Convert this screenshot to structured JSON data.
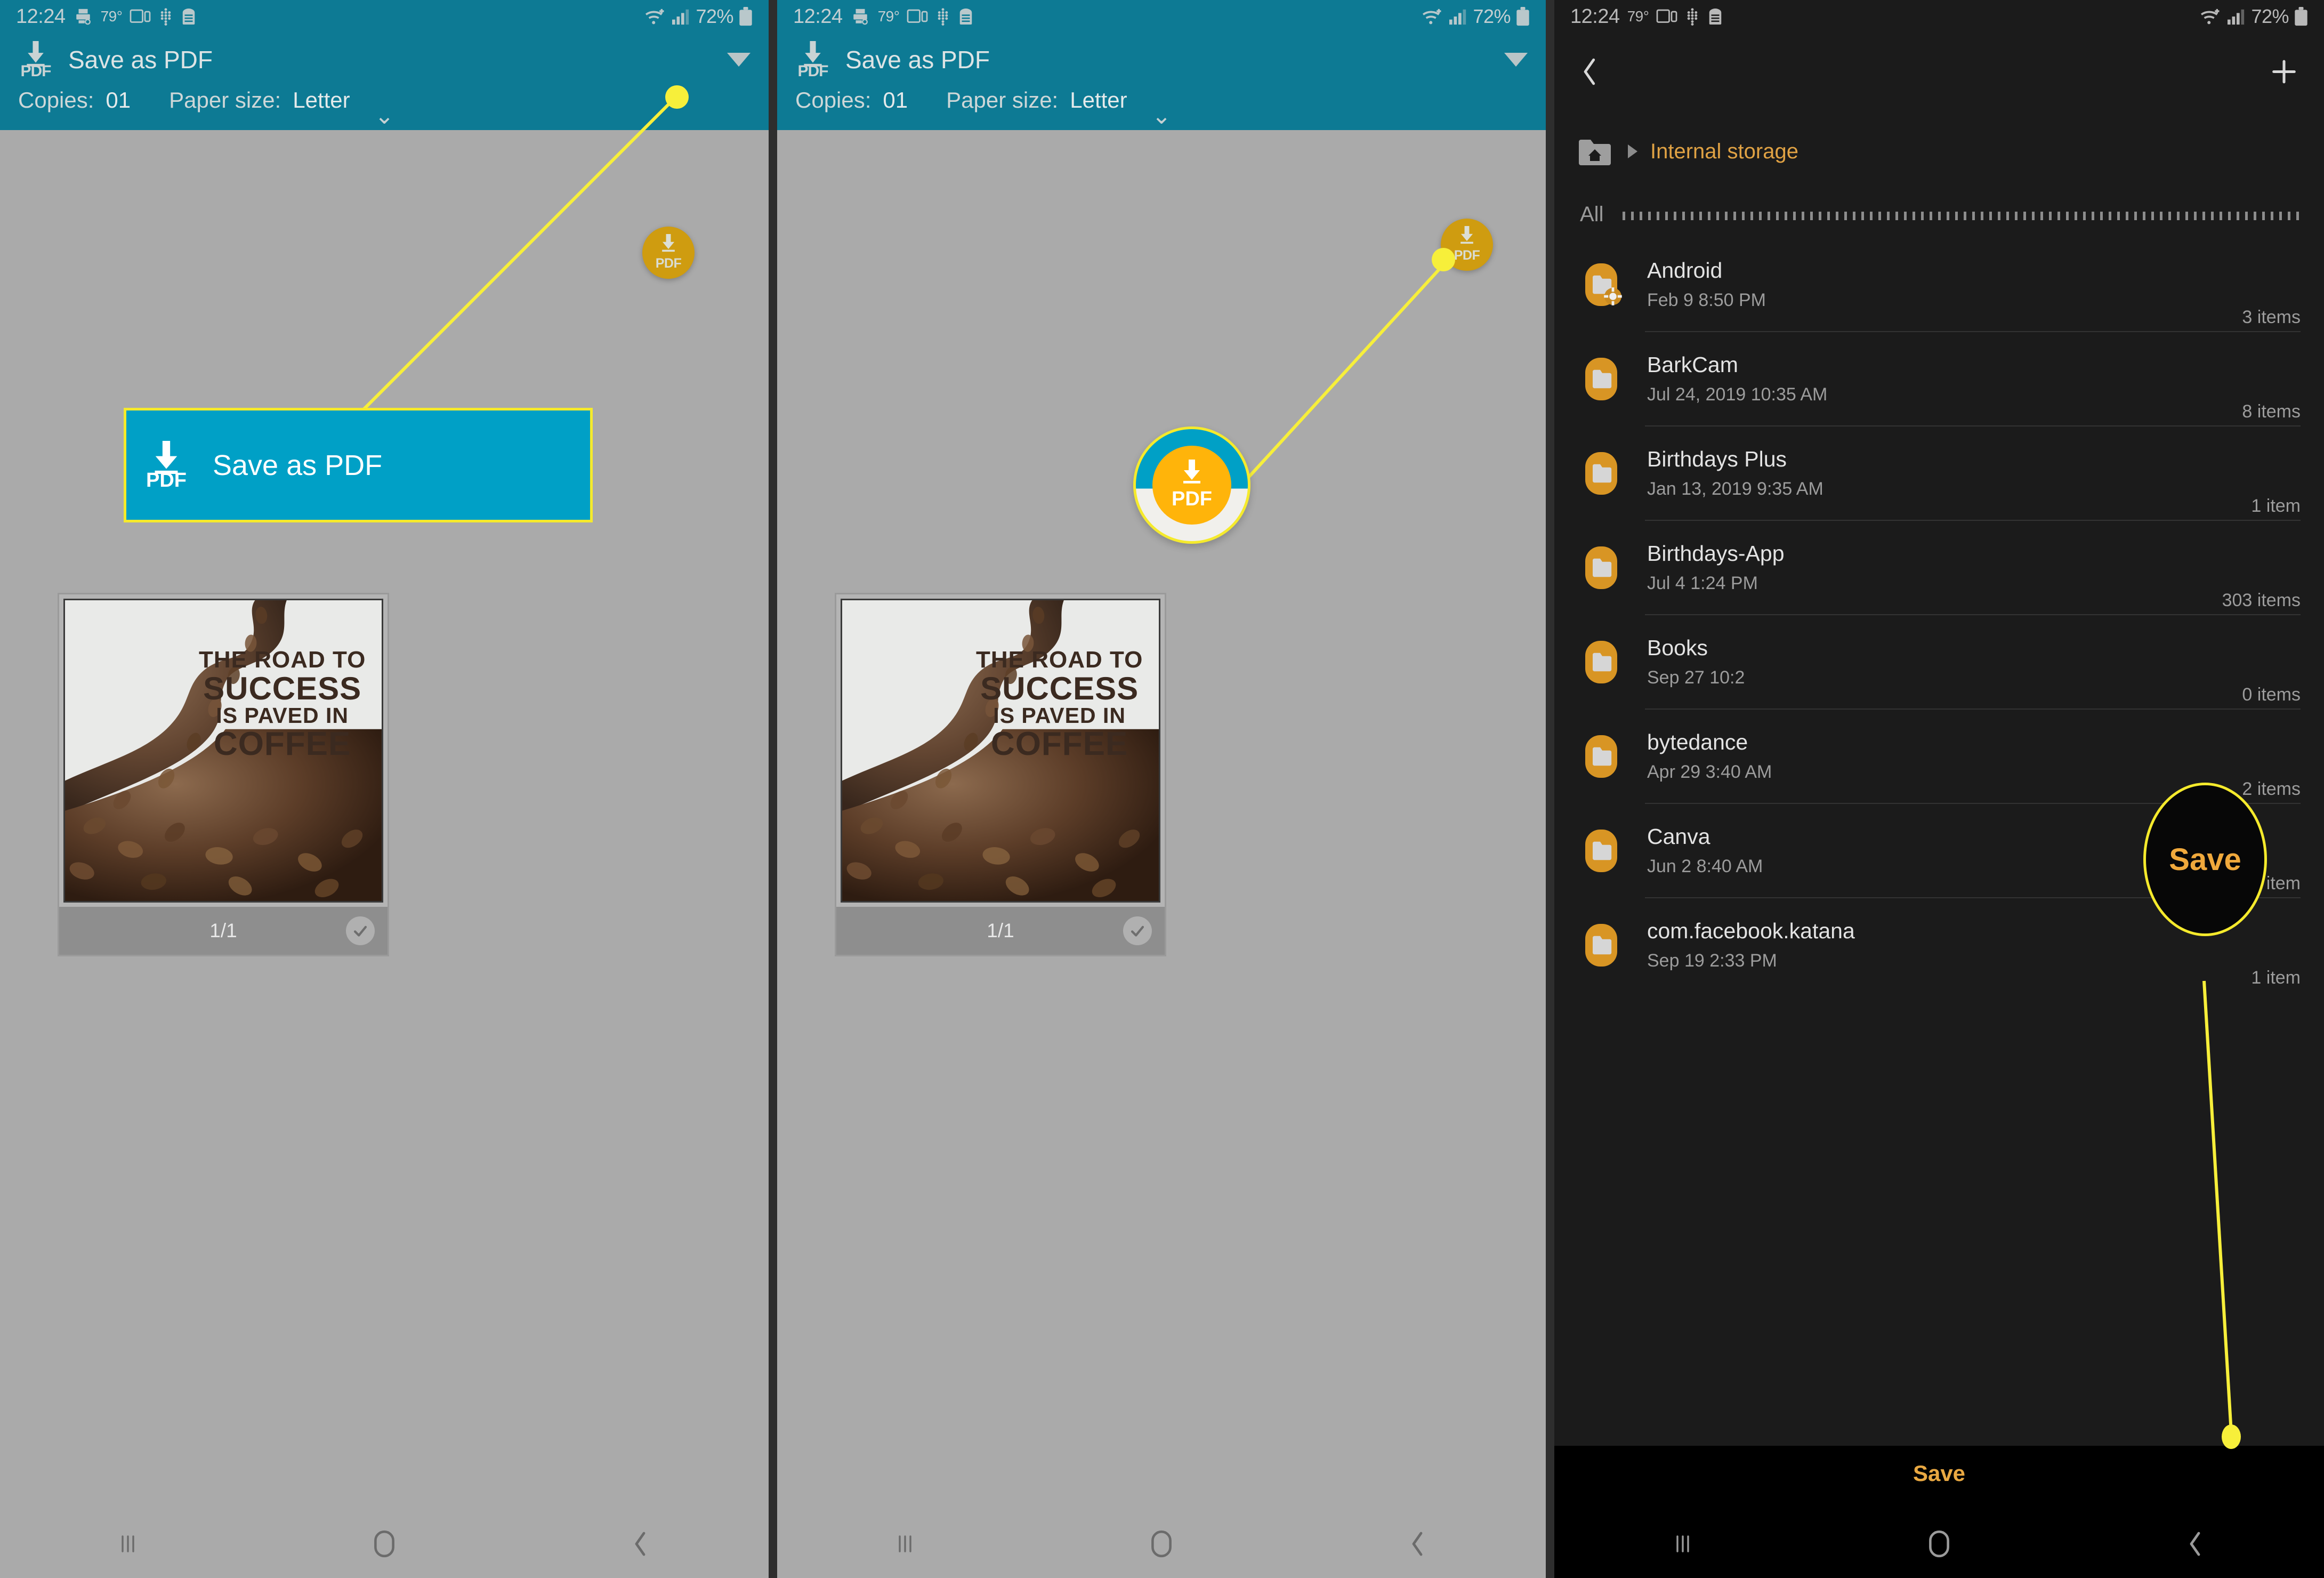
{
  "status_bar": {
    "time": "12:24",
    "temperature": "79°",
    "battery_percent": "72%",
    "icons": [
      "printer-icon",
      "temperature-icon",
      "screen-mirror-icon",
      "bixby-icon",
      "android-beam-icon",
      "wifi-icon",
      "signal-icon",
      "battery-icon"
    ]
  },
  "print_dialog": {
    "printer_icon": "save-as-pdf-icon",
    "printer_title": "Save as PDF",
    "expand_icon": "chevron-down-icon",
    "copies_label": "Copies:",
    "copies_value": "01",
    "paper_size_label": "Paper size:",
    "paper_size_value": "Letter",
    "more_options_icon": "chevron-down-icon",
    "fab_icon": "download-pdf-icon",
    "fab_label": "PDF"
  },
  "preview": {
    "page_indicator": "1/1",
    "check_icon": "check-icon",
    "artwork": {
      "alt": "coffee-beans-poster",
      "quote_line1": "THE ROAD TO",
      "quote_line2": "SUCCESS",
      "quote_line3": "IS PAVED IN",
      "quote_line4": "COFFEE"
    }
  },
  "callouts": {
    "panel_a": {
      "badge_label": "PDF",
      "label": "Save as PDF"
    },
    "panel_b": {
      "label": "PDF"
    },
    "panel_c_bubble": {
      "label": "Save"
    }
  },
  "nav_bar": {
    "recents_icon": "recents-icon",
    "home_icon": "home-icon",
    "back_icon": "back-icon"
  },
  "file_manager": {
    "back_icon": "chevron-left-icon",
    "add_icon": "plus-icon",
    "breadcrumb": {
      "home_icon": "home-folder-icon",
      "separator_icon": "triangle-right-icon",
      "path": "Internal storage"
    },
    "section_label": "All",
    "save_button": "Save",
    "items": [
      {
        "icon": "folder-settings-icon",
        "name": "Android",
        "date": "Feb 9 8:50 PM",
        "count": "3 items"
      },
      {
        "icon": "folder-icon",
        "name": "BarkCam",
        "date": "Jul 24, 2019 10:35 AM",
        "count": "8 items"
      },
      {
        "icon": "folder-icon",
        "name": "Birthdays Plus",
        "date": "Jan 13, 2019 9:35 AM",
        "count": "1 item"
      },
      {
        "icon": "folder-icon",
        "name": "Birthdays-App",
        "date": "Jul 4 1:24 PM",
        "count": "303 items"
      },
      {
        "icon": "folder-icon",
        "name": "Books",
        "date": "Sep 27 10:2",
        "count": "0 items"
      },
      {
        "icon": "folder-icon",
        "name": "bytedance",
        "date": "Apr 29 3:40 AM",
        "count": "2 items"
      },
      {
        "icon": "folder-icon",
        "name": "Canva",
        "date": "Jun 2 8:40 AM",
        "count": "1 item"
      },
      {
        "icon": "folder-icon",
        "name": "com.facebook.katana",
        "date": "Sep 19 2:33 PM",
        "count": "1 item"
      }
    ]
  },
  "colors": {
    "teal_header": "#0d7a94",
    "page_bg": "#aaaaaa",
    "fab_amber": "#cf9c10",
    "callout_cyan": "#00a0c6",
    "callout_yellow": "#f5ea2c",
    "folder_orange": "#d89524",
    "dark_bg": "#1b1b1b",
    "accent_orange": "#e0a244"
  }
}
